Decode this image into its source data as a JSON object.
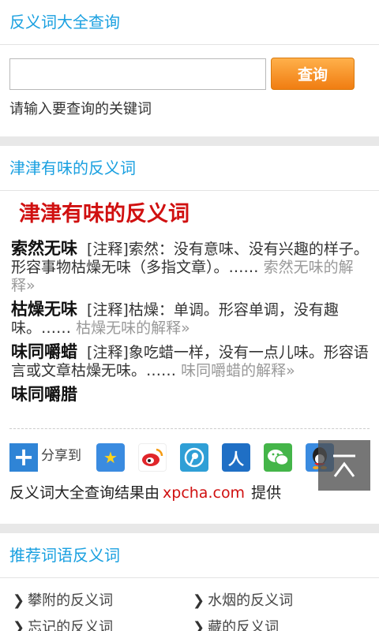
{
  "header": {
    "title": "反义词大全查询"
  },
  "search": {
    "input_value": "",
    "button_label": "查询",
    "hint": "请输入要查询的关键词"
  },
  "result_section": {
    "title": "津津有味的反义词",
    "heading": "津津有味的反义词",
    "entries": [
      {
        "word": "索然无味",
        "desc": "[注释]索然：没有意味、没有兴趣的样子。形容事物枯燥无味（多指文章）。……",
        "more": "索然无味的解释»"
      },
      {
        "word": "枯燥无味",
        "desc": "[注释]枯燥：单调。形容单调，没有趣味。……",
        "more": "枯燥无味的解释»"
      },
      {
        "word": "味同嚼蜡",
        "desc": "[注释]象吃蜡一样，没有一点儿味。形容语言或文章枯燥无味。……",
        "more": "味同嚼蜡的解释»"
      }
    ],
    "extra_word": "味同嚼腊",
    "share_label": "分享到",
    "share_icons": [
      "qzone-icon",
      "weibo-icon",
      "tencent-weibo-icon",
      "renren-icon",
      "wechat-icon",
      "qq-icon"
    ],
    "credit_prefix": "反义词大全查询结果由",
    "credit_domain": "xpcha.com",
    "credit_suffix": "提供"
  },
  "recommend_section": {
    "title": "推荐词语反义词",
    "items": [
      "攀附的反义词",
      "水烟的反义词",
      "忘记的反义词",
      "藏的反义词"
    ]
  },
  "colors": {
    "accent": "#1aa0e0",
    "red": "#d01010",
    "button": "#f07d12"
  }
}
